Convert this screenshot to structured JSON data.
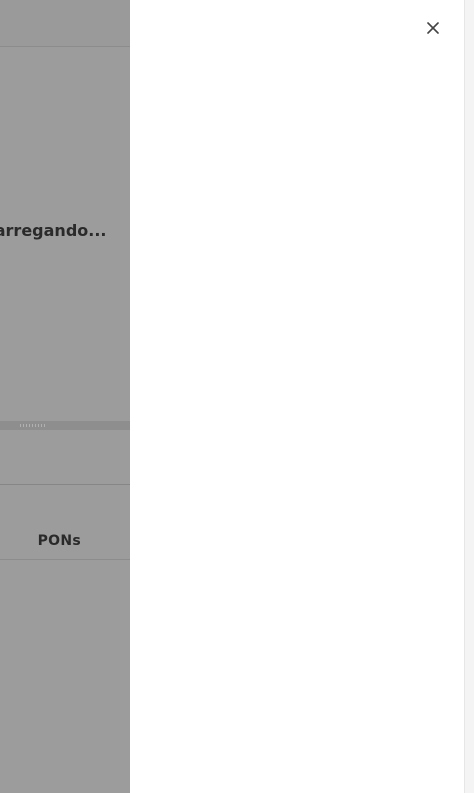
{
  "background": {
    "loading_text": "Carregando...",
    "tab_label": "PONs"
  },
  "drawer": {
    "close_icon": "close-icon"
  },
  "colors": {
    "overlay_gray": "#9c9c9c",
    "drawer_bg": "#ffffff",
    "text_dark": "#2a2a2a"
  }
}
